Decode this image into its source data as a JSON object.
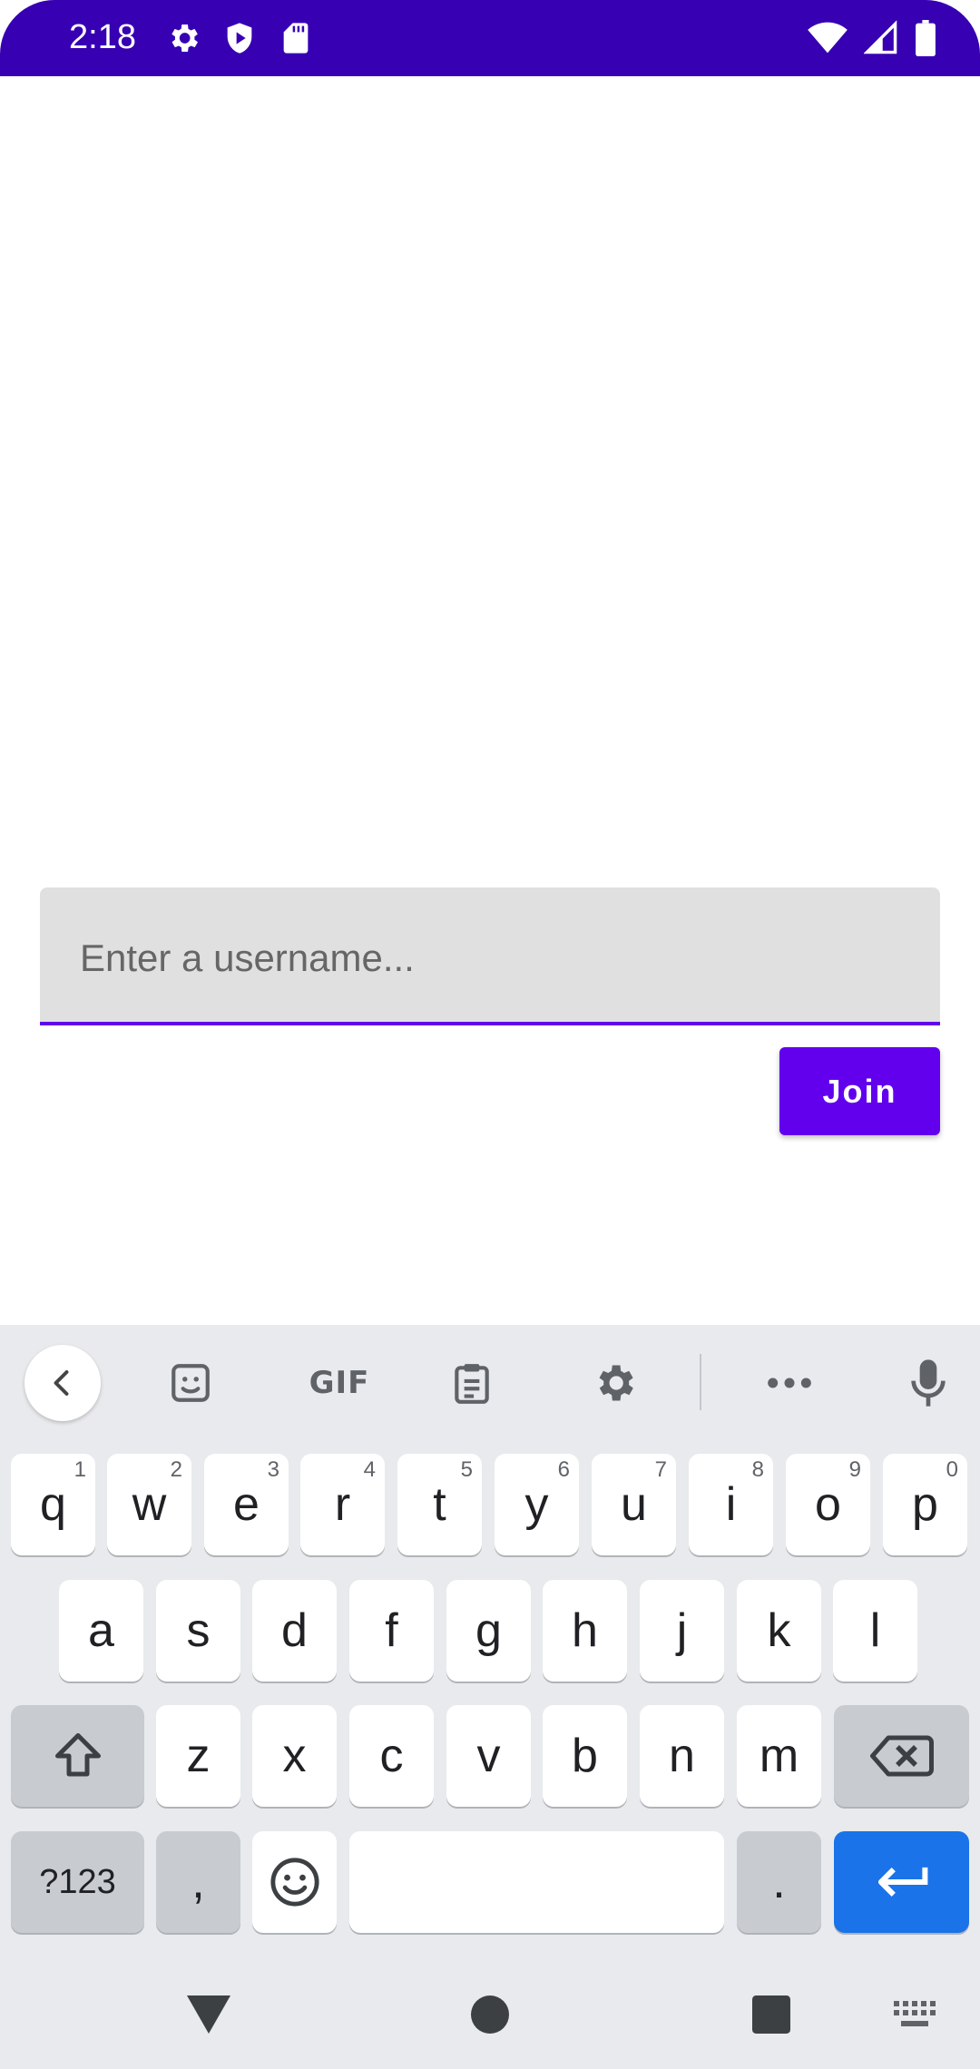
{
  "status_bar": {
    "time": "2:18",
    "background_color": "#3700B3",
    "left_icons": [
      "gear-icon",
      "shield-play-icon",
      "sd-card-icon"
    ],
    "right_icons": [
      "wifi-icon",
      "cell-signal-icon",
      "battery-icon"
    ]
  },
  "form": {
    "username_placeholder": "Enter a username...",
    "username_value": "",
    "join_label": "Join",
    "accent_color": "#6200EE"
  },
  "keyboard": {
    "toolbar": {
      "gif_label": "GIF",
      "icons": [
        "back-icon",
        "sticker-icon",
        "gif-icon",
        "clipboard-icon",
        "settings-icon",
        "more-icon",
        "mic-icon"
      ]
    },
    "row1": [
      {
        "key": "q",
        "hint": "1"
      },
      {
        "key": "w",
        "hint": "2"
      },
      {
        "key": "e",
        "hint": "3"
      },
      {
        "key": "r",
        "hint": "4"
      },
      {
        "key": "t",
        "hint": "5"
      },
      {
        "key": "y",
        "hint": "6"
      },
      {
        "key": "u",
        "hint": "7"
      },
      {
        "key": "i",
        "hint": "8"
      },
      {
        "key": "o",
        "hint": "9"
      },
      {
        "key": "p",
        "hint": "0"
      }
    ],
    "row2": [
      "a",
      "s",
      "d",
      "f",
      "g",
      "h",
      "j",
      "k",
      "l"
    ],
    "row3": [
      "z",
      "x",
      "c",
      "v",
      "b",
      "n",
      "m"
    ],
    "symbols_label": "?123",
    "comma_label": ",",
    "period_label": ".",
    "enter_color": "#1a73e8"
  },
  "nav_bar": {
    "icons": [
      "back-triangle-icon",
      "home-circle-icon",
      "recents-square-icon",
      "keyboard-switch-icon"
    ]
  }
}
